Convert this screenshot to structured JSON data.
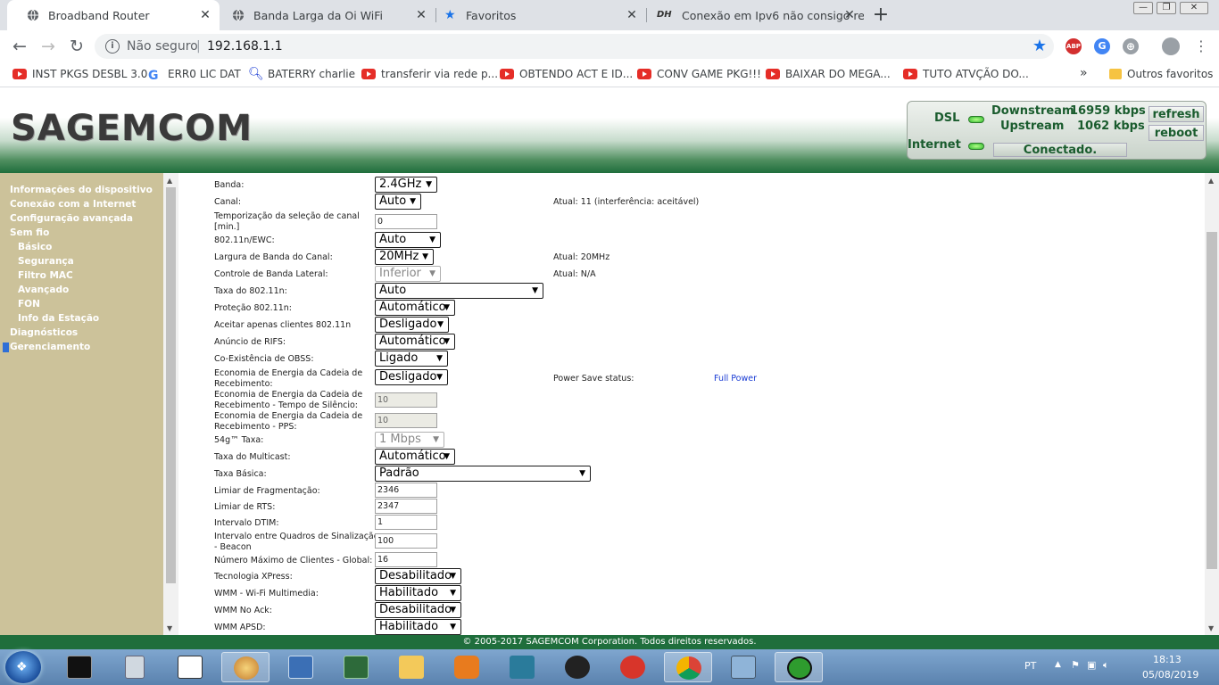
{
  "browser": {
    "tabs": [
      {
        "title": "Broadband Router",
        "active": true
      },
      {
        "title": "Banda Larga da Oi WiFi",
        "active": false
      },
      {
        "title": "Favoritos",
        "active": false
      },
      {
        "title": "Conexão em Ipv6 não consigo re",
        "active": false
      }
    ],
    "new_tab": "+",
    "window_controls": {
      "minimize": "—",
      "restore": "❐",
      "close": "✕"
    },
    "security_label": "Não seguro",
    "url": "192.168.1.1",
    "extensions": [
      "ABP",
      "G",
      "⊕"
    ],
    "bookmarks": [
      {
        "label": "INST PKGS DESBL 3.0",
        "icon": "youtube-icon"
      },
      {
        "label": "ERR0 LIC DAT",
        "icon": "google-icon"
      },
      {
        "label": "BATERRY charlie",
        "icon": "search-icon"
      },
      {
        "label": "transferir via rede p...",
        "icon": "youtube-icon"
      },
      {
        "label": "OBTENDO ACT E ID...",
        "icon": "youtube-icon"
      },
      {
        "label": "CONV GAME PKG!!!",
        "icon": "youtube-icon"
      },
      {
        "label": "BAIXAR DO MEGA...",
        "icon": "youtube-icon"
      },
      {
        "label": "TUTO ATVÇÃO DO...",
        "icon": "youtube-icon"
      }
    ],
    "bookmarks_overflow": "»",
    "other_bookmarks": "Outros favoritos"
  },
  "router": {
    "logo": "SAGEMCOM",
    "status": {
      "dsl_label": "DSL",
      "internet_label": "Internet",
      "downstream_label": "Downstream",
      "downstream_value": "16959 kbps",
      "upstream_label": "Upstream",
      "upstream_value": "1062 kbps",
      "connection": "Conectado.",
      "refresh": "refresh",
      "reboot": "reboot"
    },
    "sidebar": [
      {
        "label": "Informações do dispositivo",
        "level": "top"
      },
      {
        "label": "Conexão com a Internet",
        "level": "top"
      },
      {
        "label": "Configuração avançada",
        "level": "top"
      },
      {
        "label": "Sem fio",
        "level": "top"
      },
      {
        "label": "Básico",
        "level": "sub"
      },
      {
        "label": "Segurança",
        "level": "sub"
      },
      {
        "label": "Filtro MAC",
        "level": "sub"
      },
      {
        "label": "Avançado",
        "level": "sub"
      },
      {
        "label": "FON",
        "level": "sub"
      },
      {
        "label": "Info da Estação",
        "level": "sub"
      },
      {
        "label": "Diagnósticos",
        "level": "top"
      },
      {
        "label": "Gerenciamento",
        "level": "top"
      }
    ],
    "form": [
      {
        "label": "Banda:",
        "type": "select",
        "value": "2.4GHz"
      },
      {
        "label": "Canal:",
        "type": "select",
        "value": "Auto",
        "note": "Atual: 11 (interferência: aceitável)"
      },
      {
        "label": "Temporização da seleção de canal [min.]",
        "type": "text",
        "value": "0"
      },
      {
        "label": "802.11n/EWC:",
        "type": "select",
        "value": "Auto"
      },
      {
        "label": "Largura de Banda do Canal:",
        "type": "select",
        "value": "20MHz",
        "note": "Atual: 20MHz"
      },
      {
        "label": "Controle de Banda Lateral:",
        "type": "select-disabled",
        "value": "Inferior",
        "note": "Atual: N/A"
      },
      {
        "label": "Taxa do 802.11n:",
        "type": "select",
        "value": "Auto"
      },
      {
        "label": "Proteção 802.11n:",
        "type": "select",
        "value": "Automático"
      },
      {
        "label": "Aceitar apenas clientes 802.11n",
        "type": "select",
        "value": "Desligado"
      },
      {
        "label": "Anúncio de RIFS:",
        "type": "select",
        "value": "Automático"
      },
      {
        "label": "Co-Existência de OBSS:",
        "type": "select",
        "value": "Ligado"
      },
      {
        "label": "Economia de Energia da Cadeia de Recebimento:",
        "type": "select",
        "value": "Desligado",
        "note": "Power Save status:",
        "note_value": "Full Power"
      },
      {
        "label": "Economia de Energia da Cadeia de Recebimento - Tempo de Silêncio:",
        "type": "text-disabled",
        "value": "10"
      },
      {
        "label": "Economia de Energia da Cadeia de Recebimento - PPS:",
        "type": "text-disabled",
        "value": "10"
      },
      {
        "label": "54g™ Taxa:",
        "type": "select-disabled",
        "value": "1 Mbps"
      },
      {
        "label": "Taxa do Multicast:",
        "type": "select",
        "value": "Automático"
      },
      {
        "label": "Taxa Básica:",
        "type": "select",
        "value": "Padrão"
      },
      {
        "label": "Limiar de Fragmentação:",
        "type": "text",
        "value": "2346"
      },
      {
        "label": "Limiar de RTS:",
        "type": "text",
        "value": "2347"
      },
      {
        "label": "Intervalo DTIM:",
        "type": "text",
        "value": "1"
      },
      {
        "label": "Intervalo entre Quadros de Sinalização - Beacon",
        "type": "text",
        "value": "100"
      },
      {
        "label": "Número Máximo de Clientes - Global:",
        "type": "text",
        "value": "16"
      },
      {
        "label": "Tecnologia XPress:",
        "type": "select",
        "value": "Desabilitado"
      },
      {
        "label": "WMM - Wi-Fi Multimedia:",
        "type": "select",
        "value": "Habilitado"
      },
      {
        "label": "WMM No Ack:",
        "type": "select",
        "value": "Desabilitado"
      },
      {
        "label": "WMM APSD:",
        "type": "select",
        "value": "Habilitado"
      }
    ],
    "footer": "© 2005-2017 SAGEMCOM Corporation. Todos direitos reservados."
  },
  "taskbar": {
    "language": "PT",
    "time": "18:13",
    "date": "05/08/2019"
  },
  "colors": {
    "router_green": "#1f6e3c",
    "sidebar_bg": "#ccc29a",
    "chrome_blue": "#1a73e8"
  }
}
